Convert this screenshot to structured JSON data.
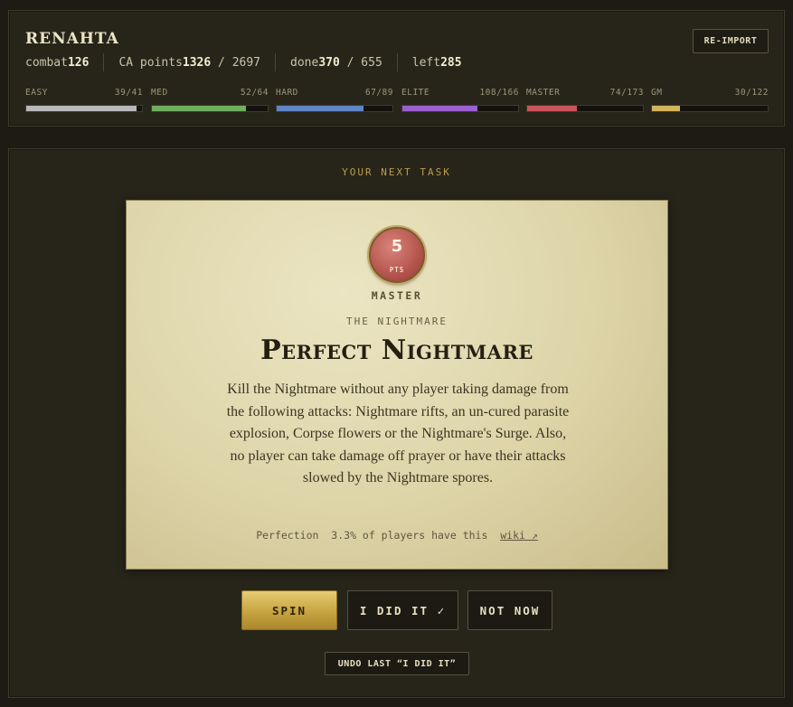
{
  "header": {
    "player_name": "RENAHTA",
    "reimport_label": "RE-IMPORT",
    "stats": {
      "combat_label": "combat",
      "combat_value": "126",
      "ca_label": "CA points",
      "ca_value": "1326",
      "ca_total": "2697",
      "done_label": "done",
      "done_value": "370",
      "done_total": "655",
      "left_label": "left",
      "left_value": "285"
    }
  },
  "tiers": [
    {
      "name": "EASY",
      "count": "39/41",
      "done": 39,
      "total": 41,
      "color": "#b8b8b8"
    },
    {
      "name": "MED",
      "count": "52/64",
      "done": 52,
      "total": 64,
      "color": "#6fae5f"
    },
    {
      "name": "HARD",
      "count": "67/89",
      "done": 67,
      "total": 89,
      "color": "#5f86c6"
    },
    {
      "name": "ELITE",
      "count": "108/166",
      "done": 108,
      "total": 166,
      "color": "#9b5fd1"
    },
    {
      "name": "MASTER",
      "count": "74/173",
      "done": 74,
      "total": 173,
      "color": "#c9545a"
    },
    {
      "name": "GM",
      "count": "30/122",
      "done": 30,
      "total": 122,
      "color": "#d4b45a"
    }
  ],
  "task": {
    "section_label": "YOUR NEXT TASK",
    "points": "5",
    "points_unit": "PTS",
    "tier": "MASTER",
    "boss": "THE NIGHTMARE",
    "title": "Perfect Nightmare",
    "description": "Kill the Nightmare without any player taking damage from the following attacks: Nightmare rifts, an un-cured parasite explosion, Corpse flowers or the Nightmare's Surge. Also, no player can take damage off prayer or have their attacks slowed by the Nightmare spores.",
    "type": "Perfection",
    "completion": "3.3% of players have this",
    "wiki_label": "wiki ↗"
  },
  "actions": {
    "spin_label": "SPIN",
    "did_it_label": "I DID IT ✓",
    "not_now_label": "NOT NOW",
    "undo_label": "UNDO LAST “I DID IT”"
  }
}
